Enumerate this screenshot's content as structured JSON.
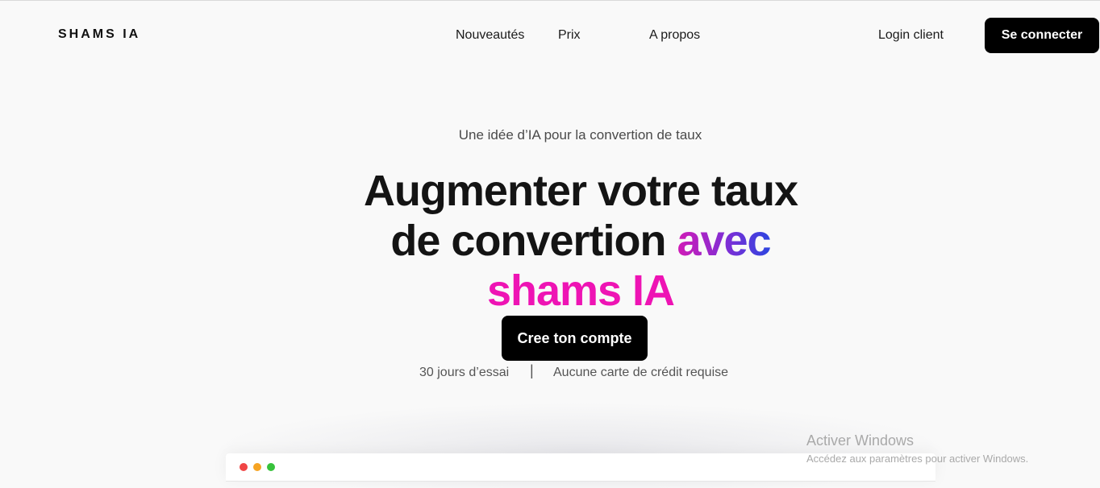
{
  "header": {
    "logo": "SHAMS IA",
    "nav": [
      "Nouveautés",
      "Prix",
      "A propos"
    ],
    "login_label": "Login client",
    "connect_label": "Se connecter"
  },
  "hero": {
    "eyebrow": "Une idée d’IA pour la convertion de taux",
    "headline_line1": "Augmenter votre taux",
    "headline_line2_plain": "de convertion ",
    "headline_line2_accent": "avec",
    "headline_line3": "shams IA",
    "cta_label": "Cree ton compte",
    "trial_text": "30 jours d’essai",
    "separator": "|",
    "no_card_text": "Aucune carte de crédit requise"
  },
  "window_mock": {
    "dots": [
      "red",
      "yellow",
      "green"
    ]
  },
  "watermark": {
    "title": "Activer Windows",
    "subtitle": "Accédez aux paramètres pour activer Windows."
  },
  "colors": {
    "background": "#f9f9f9",
    "button": "#000000",
    "accent_pink": "#ee14b4",
    "gradient_start": "#d21bb6",
    "gradient_end": "#2b45e0"
  }
}
